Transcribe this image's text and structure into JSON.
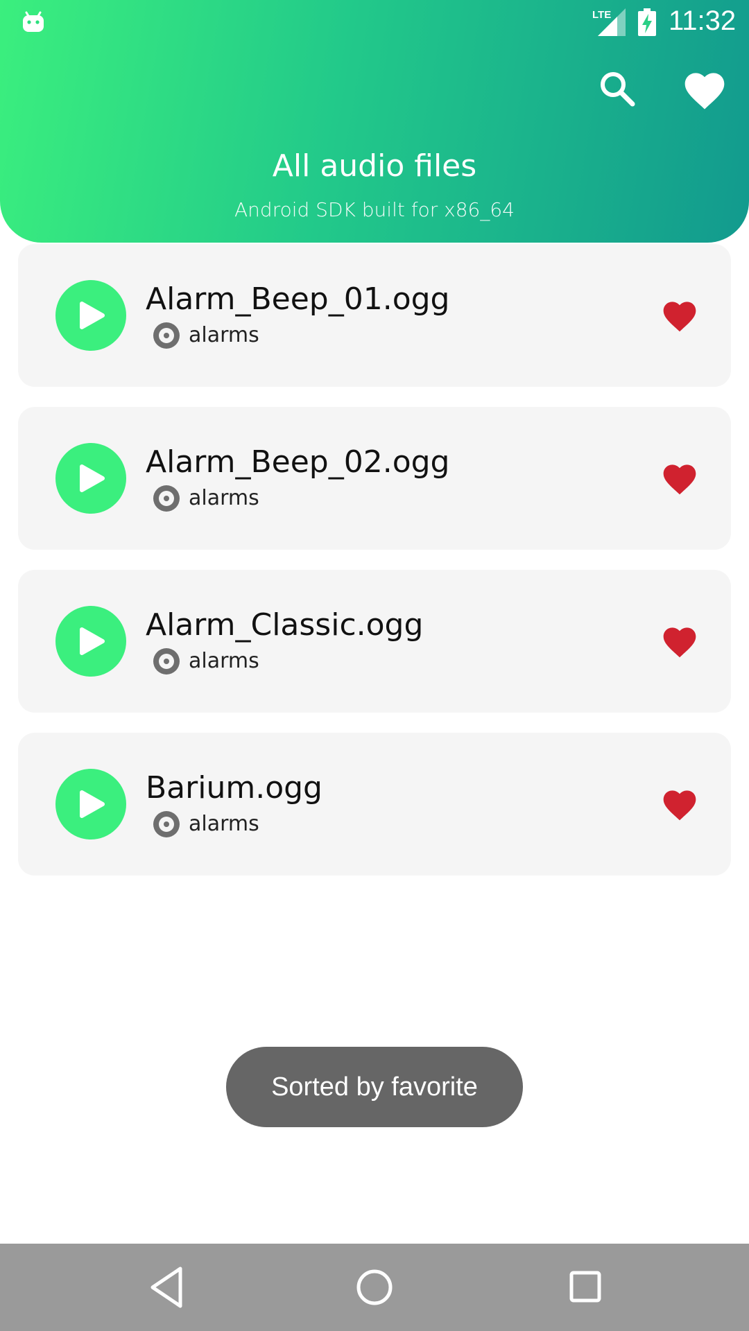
{
  "status_bar": {
    "time": "11:32",
    "network_label": "LTE",
    "icons": [
      "android-icon",
      "lte-signal-icon",
      "battery-charging-icon"
    ]
  },
  "header": {
    "title": "All audio files",
    "subtitle": "Android SDK built for x86_64",
    "actions": [
      "search-icon",
      "heart-icon"
    ],
    "gradient": [
      "#3bef7e",
      "#129a8e"
    ]
  },
  "files": [
    {
      "name": "Alarm_Beep_01.ogg",
      "folder": "alarms",
      "favorite": true
    },
    {
      "name": "Alarm_Beep_02.ogg",
      "folder": "alarms",
      "favorite": true
    },
    {
      "name": "Alarm_Classic.ogg",
      "folder": "alarms",
      "favorite": true
    },
    {
      "name": "Barium.ogg",
      "folder": "alarms",
      "favorite": true
    }
  ],
  "toast": {
    "text": "Sorted by favorite"
  },
  "nav_bar": [
    "back-icon",
    "home-icon",
    "recents-icon"
  ],
  "colors": {
    "accent_green": "#3bef7e",
    "favorite_red": "#d0222f",
    "card_bg": "#f5f5f5",
    "toast_bg": "#666666",
    "nav_bg": "#9a9a9a"
  }
}
